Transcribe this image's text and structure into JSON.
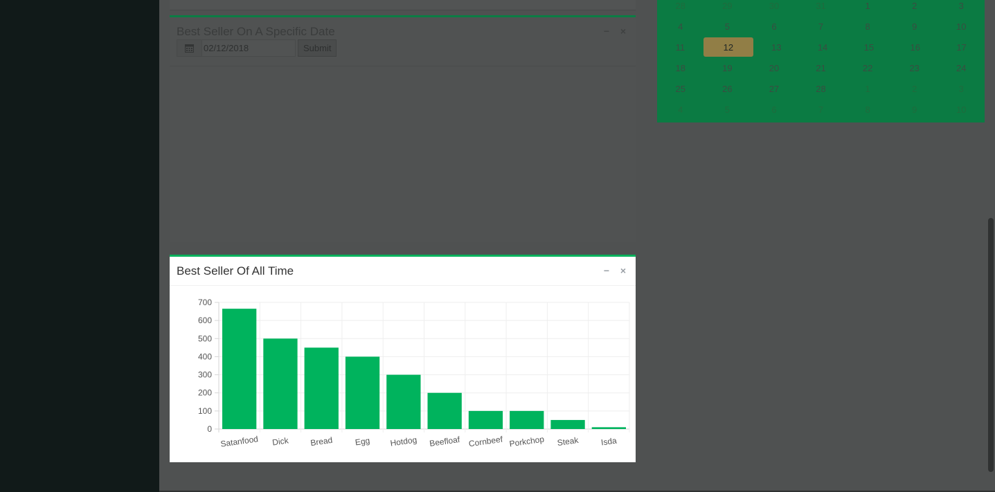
{
  "date_box": {
    "title": "Best Seller On A Specific Date",
    "date_value": "02/12/2018",
    "submit_label": "Submit",
    "minimize_label": "−",
    "close_label": "×"
  },
  "chart_box": {
    "title": "Best Seller Of All Time",
    "minimize_label": "−",
    "close_label": "×"
  },
  "calendar": {
    "selected_day": "12",
    "weeks": [
      [
        {
          "d": "28",
          "m": true
        },
        {
          "d": "29",
          "m": true
        },
        {
          "d": "30",
          "m": true
        },
        {
          "d": "31",
          "m": true
        },
        {
          "d": "1"
        },
        {
          "d": "2"
        },
        {
          "d": "3"
        }
      ],
      [
        {
          "d": "4"
        },
        {
          "d": "5"
        },
        {
          "d": "6"
        },
        {
          "d": "7"
        },
        {
          "d": "8"
        },
        {
          "d": "9"
        },
        {
          "d": "10"
        }
      ],
      [
        {
          "d": "11"
        },
        {
          "d": "12",
          "sel": true
        },
        {
          "d": "13"
        },
        {
          "d": "14"
        },
        {
          "d": "15"
        },
        {
          "d": "16"
        },
        {
          "d": "17"
        }
      ],
      [
        {
          "d": "18"
        },
        {
          "d": "19"
        },
        {
          "d": "20"
        },
        {
          "d": "21"
        },
        {
          "d": "22"
        },
        {
          "d": "23"
        },
        {
          "d": "24"
        }
      ],
      [
        {
          "d": "25"
        },
        {
          "d": "26"
        },
        {
          "d": "27"
        },
        {
          "d": "28"
        },
        {
          "d": "1",
          "m": true
        },
        {
          "d": "2",
          "m": true
        },
        {
          "d": "3",
          "m": true
        }
      ],
      [
        {
          "d": "4",
          "m": true
        },
        {
          "d": "5",
          "m": true
        },
        {
          "d": "6",
          "m": true
        },
        {
          "d": "7",
          "m": true
        },
        {
          "d": "8",
          "m": true
        },
        {
          "d": "9",
          "m": true
        },
        {
          "d": "10",
          "m": true
        }
      ]
    ]
  },
  "colors": {
    "bar": "#00b35d",
    "accent": "#00b15b",
    "calendar_bg": "#0b7b43"
  },
  "chart_data": {
    "type": "bar",
    "categories": [
      "Satanfood",
      "Dick",
      "Bread",
      "Egg",
      "Hotdog",
      "Beefloaf",
      "Cornbeef",
      "Porkchop",
      "Steak",
      "Isda"
    ],
    "values": [
      665,
      500,
      450,
      400,
      300,
      200,
      100,
      100,
      50,
      10
    ],
    "title": "Best Seller Of All Time",
    "ylim": [
      0,
      700
    ],
    "yticks": [
      "0",
      "100",
      "200",
      "300",
      "400",
      "500",
      "600",
      "700"
    ],
    "grid": true,
    "legend": "none"
  }
}
